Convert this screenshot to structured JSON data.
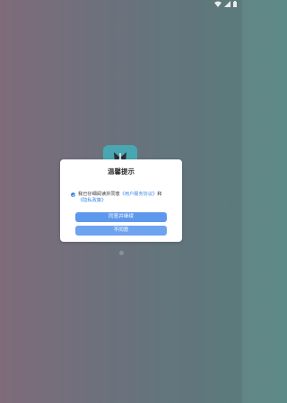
{
  "status_bar": {
    "icons": [
      "wifi-icon",
      "signal-icon",
      "battery-icon"
    ]
  },
  "dialog": {
    "title": "温馨提示",
    "consent_prefix": "我已仔细阅读并同意",
    "user_agreement_link": "《用户服务协议》",
    "conjunction": "和",
    "privacy_policy_link": "《隐私政策》",
    "agree_button": "同意并继续",
    "disagree_button": "不同意"
  },
  "colors": {
    "accent": "#3b86e6",
    "button_primary": "#5d98ec",
    "button_secondary": "#6ea3ef",
    "app_logo": "#4fb6bf"
  }
}
